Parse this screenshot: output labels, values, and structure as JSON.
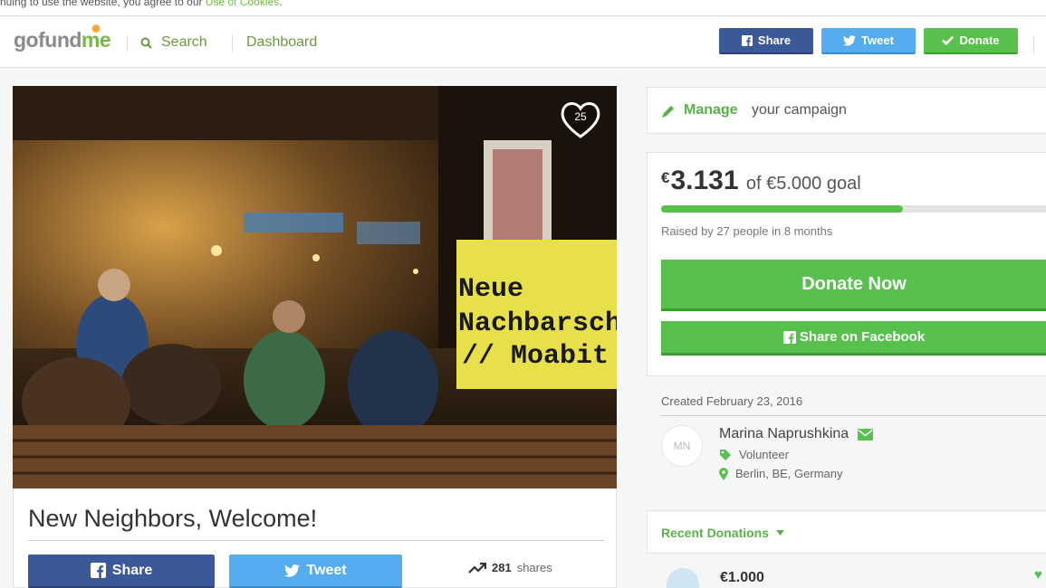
{
  "cookie_bar": {
    "text": "nuing to use the website, you agree to our ",
    "link": "Use of Cookies",
    "end": "."
  },
  "header": {
    "logo": {
      "go": "go",
      "fund": "fund",
      "me": "me"
    },
    "search_label": "Search",
    "dashboard_label": "Dashboard",
    "share_label": "Share",
    "tweet_label": "Tweet",
    "donate_label": "Donate"
  },
  "campaign": {
    "favorites_count": "25",
    "title": "New Neighbors, Welcome!",
    "share_label": "Share",
    "tweet_label": "Tweet",
    "shares_count": "281",
    "shares_label": "shares",
    "hero_sign_lines": [
      "Neue",
      "Nachbarsch",
      "// Moabit"
    ]
  },
  "sidebar": {
    "manage_label": "Manage",
    "manage_rest": "your campaign",
    "currency": "€",
    "raised": "3.131",
    "goal_text": "of €5.000 goal",
    "progress_fraction": 0.6262,
    "raised_by": "Raised by 27 people in 8 months",
    "donate_now": "Donate Now",
    "share_facebook": "Share on Facebook",
    "created": "Created February 23, 2016",
    "organizer": {
      "initials": "MN",
      "name": "Marina Naprushkina",
      "role": "Volunteer",
      "location": "Berlin, BE, Germany"
    },
    "recent_label": "Recent Donations",
    "first_donation": "€1.000"
  },
  "colors": {
    "green": "#58c04c",
    "facebook": "#3b5998",
    "twitter": "#55acee"
  }
}
